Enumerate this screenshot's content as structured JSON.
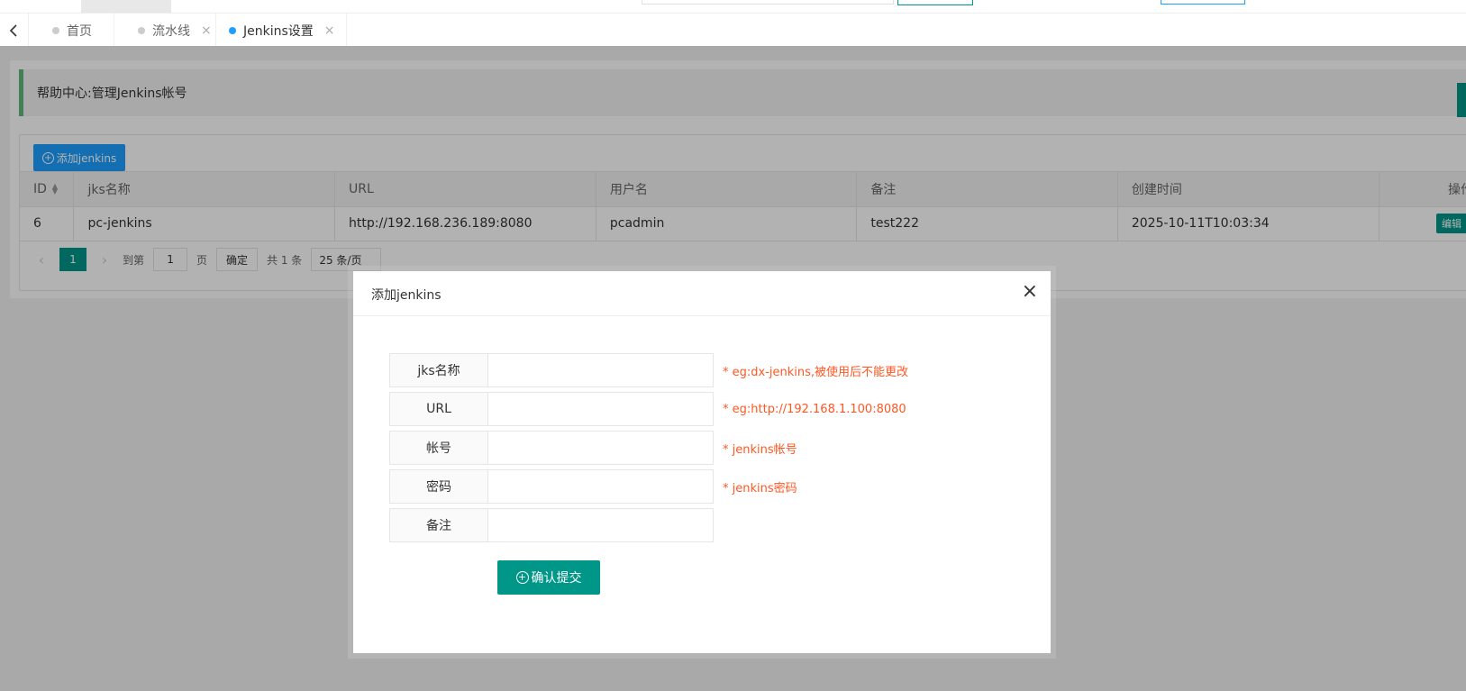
{
  "tabs": [
    {
      "label": "首页",
      "closable": false,
      "active": false
    },
    {
      "label": "流水线",
      "closable": true,
      "active": false
    },
    {
      "label": "Jenkins设置",
      "closable": true,
      "active": true
    }
  ],
  "close_glyph": "×",
  "help": {
    "text": "帮助中心:管理Jenkins帐号"
  },
  "toolbar": {
    "add_label": "添加jenkins"
  },
  "table": {
    "columns": [
      "ID",
      "jks名称",
      "URL",
      "用户名",
      "备注",
      "创建时间",
      "操作"
    ],
    "rows": [
      {
        "id": "6",
        "name": "pc-jenkins",
        "url": "http://192.168.236.189:8080",
        "user": "pcadmin",
        "remark": "test222",
        "created": "2025-10-11T10:03:34",
        "edit_label": "编辑"
      }
    ]
  },
  "pager": {
    "current": "1",
    "goto_label": "到第",
    "goto_value": "1",
    "page_unit": "页",
    "ok_label": "确定",
    "total": "共 1 条",
    "limit": "25 条/页"
  },
  "modal": {
    "title": "添加jenkins",
    "fields": [
      {
        "label": "jks名称",
        "value": "",
        "hint": "* eg:dx-jenkins,被使用后不能更改"
      },
      {
        "label": "URL",
        "value": "",
        "hint": "* eg:http://192.168.1.100:8080"
      },
      {
        "label": "帐号",
        "value": "",
        "hint": "* jenkins帐号"
      },
      {
        "label": "密码",
        "value": "",
        "hint": "* jenkins密码"
      },
      {
        "label": "备注",
        "value": "",
        "hint": ""
      }
    ],
    "submit_label": "确认提交"
  },
  "colors": {
    "primary": "#009688",
    "blue": "#1e9fff",
    "danger": "#ff5722",
    "green_bar": "#5fb878"
  }
}
